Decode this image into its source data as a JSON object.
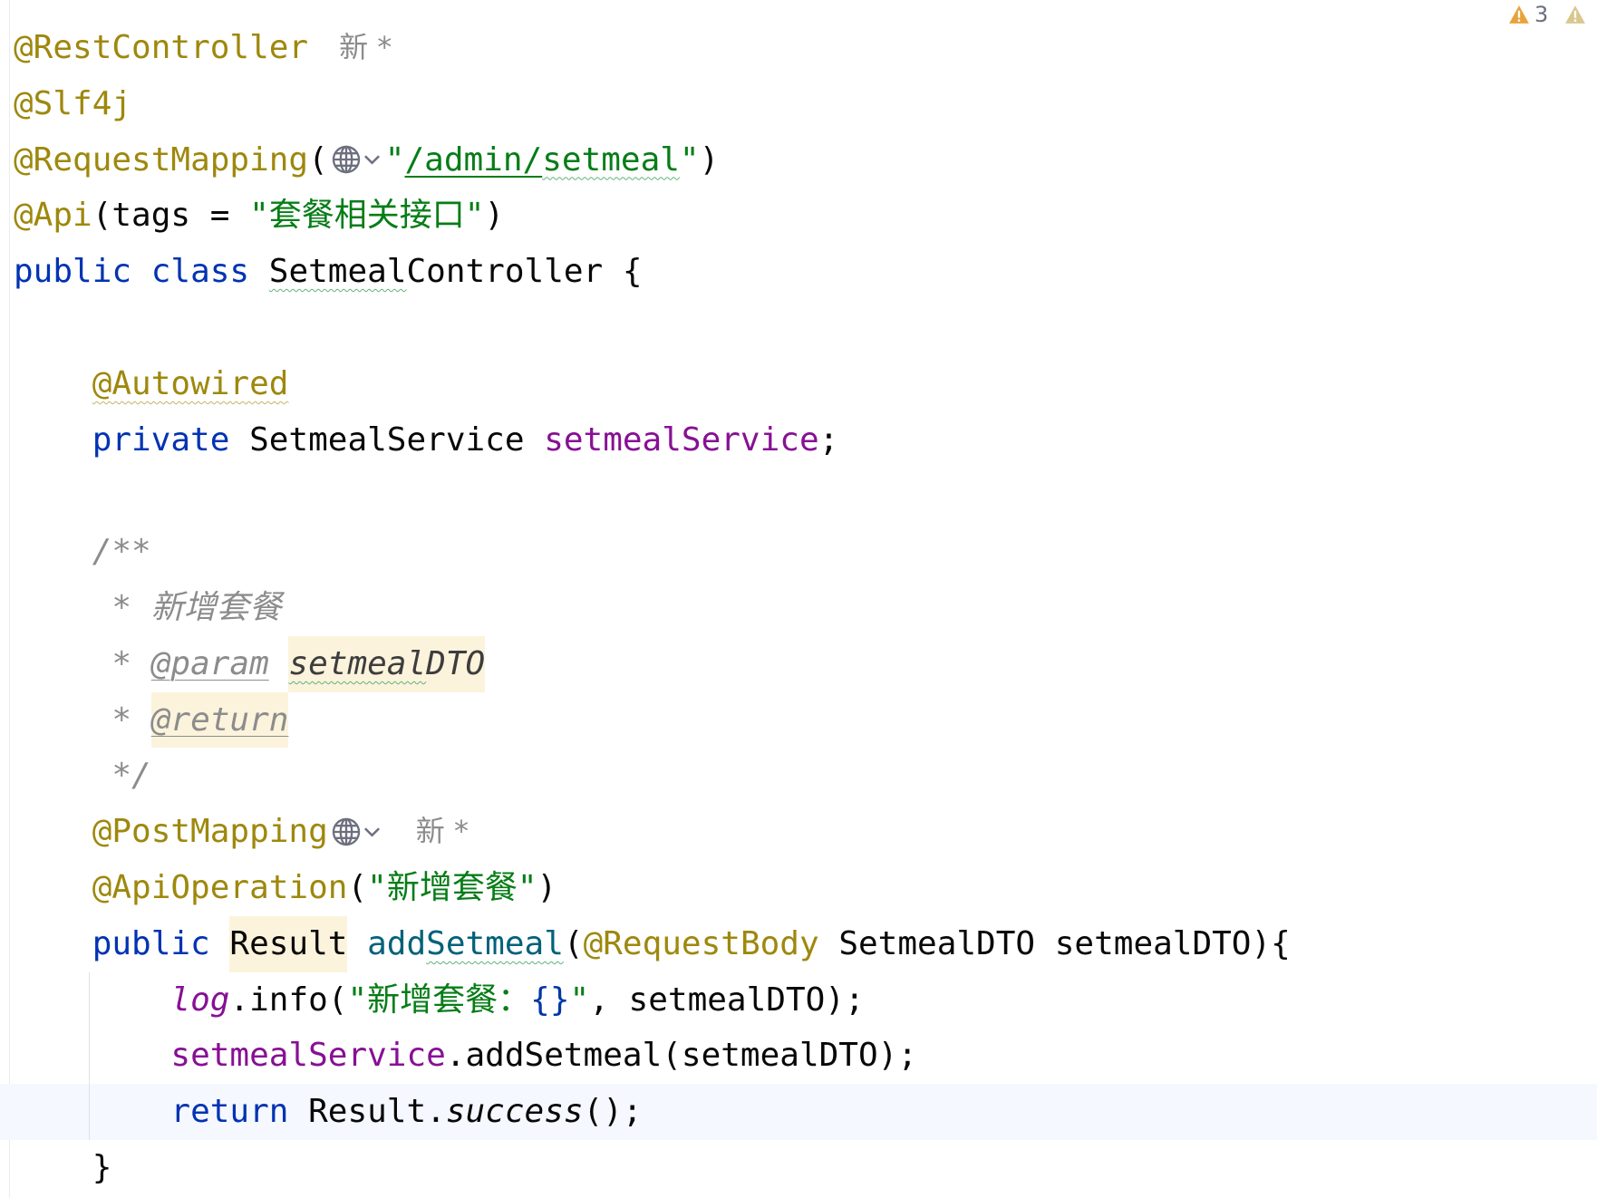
{
  "inspection_widget": {
    "warnings_count": "3",
    "icons": [
      "warning-icon",
      "weak-warning-icon"
    ],
    "colors": {
      "warning": "#e9a23b",
      "weak_warning": "#d9c78d"
    }
  },
  "editor": {
    "author_hints": [
      "新 *",
      "新 *"
    ],
    "icons": [
      "globe-icon",
      "chevron-down-icon"
    ],
    "colors": {
      "annotation": "#9e880d",
      "keyword": "#0033b3",
      "string": "#067d17",
      "field": "#871094",
      "method_declaration": "#00627a",
      "doc_comment": "#8c8c8c",
      "doc_param": "#3d3d3d",
      "format_placeholder": "#0037a6",
      "plain_text": "#080808",
      "current_line_background": "#f5f8fe",
      "highlight_background": "#fcf3dc",
      "typo_underline": "#5fb37b",
      "warning_underline": "#c4b36a"
    },
    "lines": [
      [
        "@RestController"
      ],
      [
        "@Slf4j"
      ],
      [
        "@RequestMapping",
        "(",
        "\"",
        "/admin/",
        "setmeal",
        "\"",
        ")"
      ],
      [
        "@Api",
        "(tags = ",
        "\"套餐相关接口\"",
        ")"
      ],
      [
        "public ",
        "class ",
        "Setmeal",
        "Controller {"
      ],
      [],
      [
        "@Autowired"
      ],
      [
        "private ",
        "SetmealService ",
        "setmealService",
        ";"
      ],
      [],
      [
        "/**"
      ],
      [
        " * ",
        "新增套餐"
      ],
      [
        " * ",
        "@param",
        "setmeal",
        "DTO"
      ],
      [
        " * ",
        "@return"
      ],
      [
        " */"
      ],
      [
        "@PostMapping"
      ],
      [
        "@ApiOperation",
        "(",
        "\"新增套餐\"",
        ")"
      ],
      [
        "public ",
        "Result",
        " add",
        "Setmeal",
        "(",
        "@RequestBody",
        " SetmealDTO setmealDTO){"
      ],
      [
        "log",
        ".info(",
        "\"新增套餐：",
        "{}",
        "\"",
        ", setmealDTO);"
      ],
      [
        "setmealService",
        ".addSetmeal(setmealDTO);"
      ],
      [
        "return ",
        "Result.",
        "success",
        "();"
      ],
      [
        "}"
      ]
    ]
  }
}
